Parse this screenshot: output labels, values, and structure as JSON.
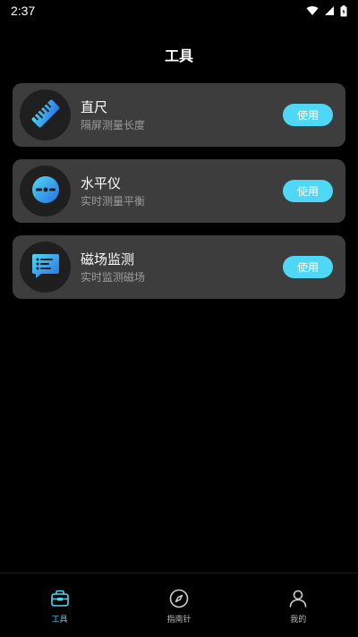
{
  "status_bar": {
    "time": "2:37"
  },
  "header": {
    "title": "工具"
  },
  "tools": [
    {
      "name": "直尺",
      "description": "隔屏测量长度",
      "button": "使用",
      "icon": "ruler-icon"
    },
    {
      "name": "水平仪",
      "description": "实时测量平衡",
      "button": "使用",
      "icon": "level-icon"
    },
    {
      "name": "磁场监测",
      "description": "实时监测磁场",
      "button": "使用",
      "icon": "magnetic-monitor-icon"
    }
  ],
  "bottom_nav": {
    "items": [
      {
        "label": "工具",
        "icon": "toolbox-icon",
        "active": true
      },
      {
        "label": "指南针",
        "icon": "compass-icon",
        "active": false
      },
      {
        "label": "我的",
        "icon": "user-icon",
        "active": false
      }
    ]
  },
  "colors": {
    "accent": "#4fd8f5",
    "card": "#3d3d3d",
    "background": "#000000"
  }
}
